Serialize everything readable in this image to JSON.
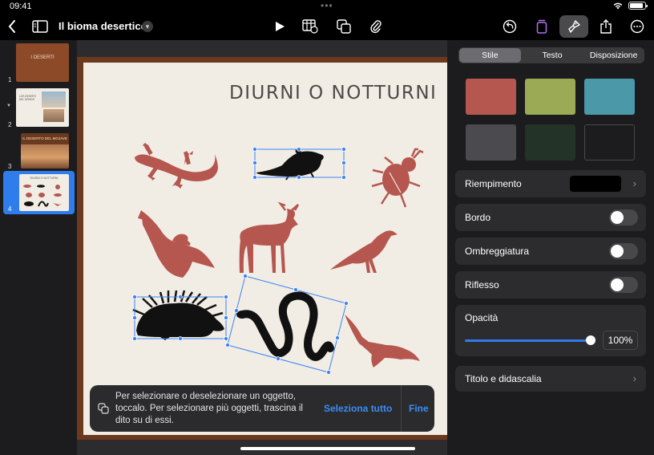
{
  "status_bar": {
    "time": "09:41",
    "battery_percent": 100
  },
  "toolbar": {
    "doc_title": "Il bioma desertico",
    "colors": {
      "accent": "#2f7dec",
      "active_tool_bg": "#4a4a4c"
    }
  },
  "navigator": {
    "slides": [
      {
        "number": "1",
        "title": "I DESERTI"
      },
      {
        "number": "2",
        "title": "LOS DESERTI DEL MONDO"
      },
      {
        "number": "3",
        "title": "IL DESERTO DEL MOJAVE"
      },
      {
        "number": "4",
        "title": "DIURNI O NOTTURNI",
        "selected": true
      }
    ]
  },
  "slide": {
    "title": "DIURNI O NOTTURNI",
    "objects": [
      {
        "name": "lizard",
        "color": "#b5574f",
        "selected": false
      },
      {
        "name": "rat",
        "color": "#111111",
        "selected": true
      },
      {
        "name": "beetle",
        "color": "#b5574f",
        "selected": false
      },
      {
        "name": "hawk",
        "color": "#b5574f",
        "selected": false
      },
      {
        "name": "deer",
        "color": "#b5574f",
        "selected": false
      },
      {
        "name": "roadrunner",
        "color": "#b5574f",
        "selected": false
      },
      {
        "name": "porcupine",
        "color": "#111111",
        "selected": true
      },
      {
        "name": "snake",
        "color": "#111111",
        "selected": true
      },
      {
        "name": "bat",
        "color": "#b5574f",
        "selected": false
      }
    ]
  },
  "hint": {
    "text": "Per selezionare o deselezionare un oggetto, toccalo. Per selezionare più oggetti, trascina il dito su di essi.",
    "select_all": "Seleziona tutto",
    "done": "Fine"
  },
  "inspector": {
    "tabs": [
      "Stile",
      "Testo",
      "Disposizione"
    ],
    "active_tab": "Stile",
    "swatches": [
      "#b5574f",
      "#9aaa55",
      "#4b98a8",
      "#4a4a4f",
      "#233327",
      "#1c1c1e"
    ],
    "fill_label": "Riempimento",
    "fill_color": "#000000",
    "border_label": "Bordo",
    "shadow_label": "Ombreggiatura",
    "reflection_label": "Riflesso",
    "opacity_label": "Opacità",
    "opacity_value": "100%",
    "caption_label": "Titolo e didascalia"
  }
}
